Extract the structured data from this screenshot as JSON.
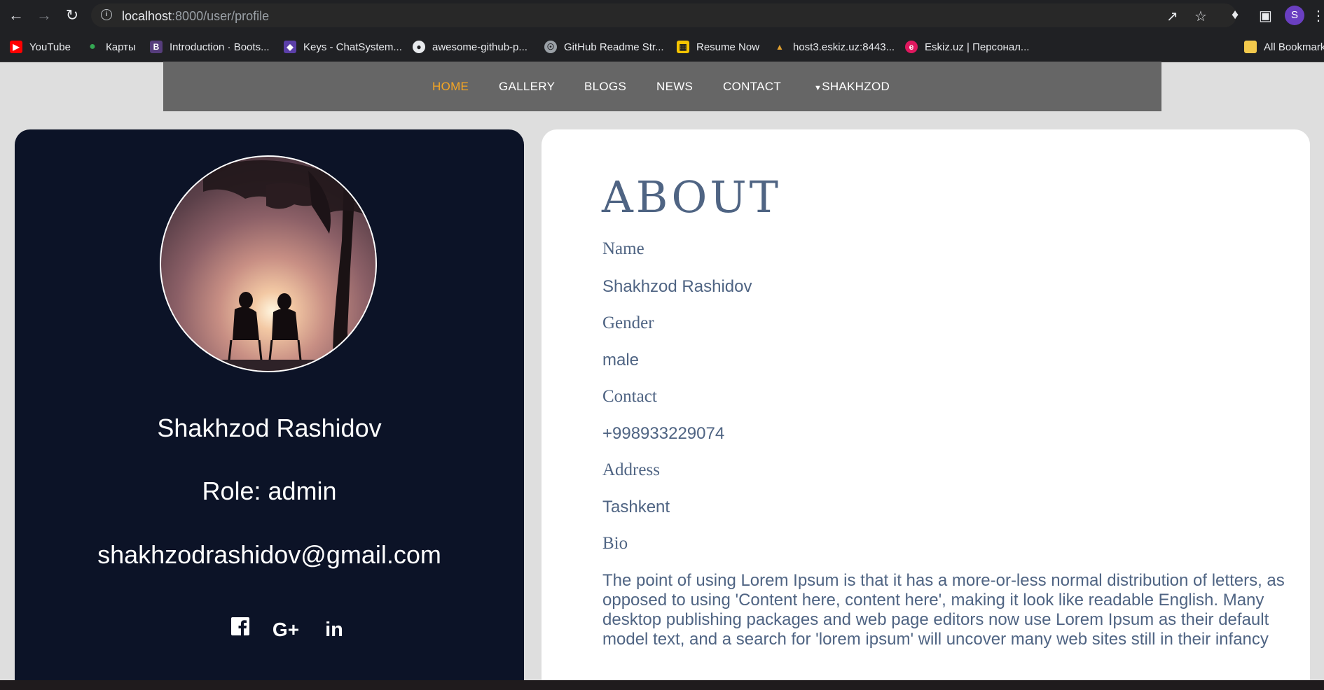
{
  "browser": {
    "url_host": "localhost",
    "url_rest": ":8000/user/profile",
    "profile_initial": "S",
    "bookmarks": [
      {
        "label": "YouTube",
        "icon": "youtube-icon",
        "color": "#ff0000"
      },
      {
        "label": "Карты",
        "icon": "maps-icon",
        "color": "#34a853"
      },
      {
        "label": "Introduction · Boots...",
        "icon": "bootstrap-icon",
        "color": "#563d7c"
      },
      {
        "label": "Keys - ChatSystem...",
        "icon": "keys-icon",
        "color": "#5b3fa8"
      },
      {
        "label": "awesome-github-p...",
        "icon": "github-icon",
        "color": "#e8eaed"
      },
      {
        "label": "GitHub Readme Str...",
        "icon": "globe-icon",
        "color": "#9aa0a6"
      },
      {
        "label": "Resume Now",
        "icon": "resume-icon",
        "color": "#f5c400"
      },
      {
        "label": "host3.eskiz.uz:8443...",
        "icon": "host-icon",
        "color": "#e0a030"
      },
      {
        "label": "Eskiz.uz | Персонал...",
        "icon": "eskiz-icon",
        "color": "#e0185f"
      },
      {
        "label": "All Bookmarks",
        "icon": "folder-icon",
        "color": "#f2c94c"
      }
    ]
  },
  "nav": {
    "items": [
      "HOME",
      "GALLERY",
      "BLOGS",
      "NEWS",
      "CONTACT"
    ],
    "user": "SHAKHZOD",
    "active_color": "#f5a623"
  },
  "profile": {
    "name": "Shakhzod Rashidov",
    "role": "Role: admin",
    "email": "shakhzodrashidov@gmail.com",
    "socials": [
      "facebook-icon",
      "google-plus-icon",
      "linkedin-icon"
    ]
  },
  "about": {
    "title": "ABOUT",
    "fields": [
      {
        "label": "Name",
        "value": "Shakhzod Rashidov"
      },
      {
        "label": "Gender",
        "value": "male"
      },
      {
        "label": "Contact",
        "value": "+998933229074"
      },
      {
        "label": "Address",
        "value": "Tashkent"
      }
    ],
    "bio_label": "Bio",
    "bio": "The point of using Lorem Ipsum is that it has a more-or-less normal distribution of letters, as opposed to using 'Content here, content here', making it look like readable English. Many desktop publishing packages and web page editors now use Lorem Ipsum as their default model text, and a search for 'lorem ipsum' will uncover many web sites still in their infancy"
  },
  "colors": {
    "card_dark": "#0c1327",
    "nav_bg": "#666666",
    "text_blue": "#4f6483",
    "page_bg": "#dedede"
  }
}
